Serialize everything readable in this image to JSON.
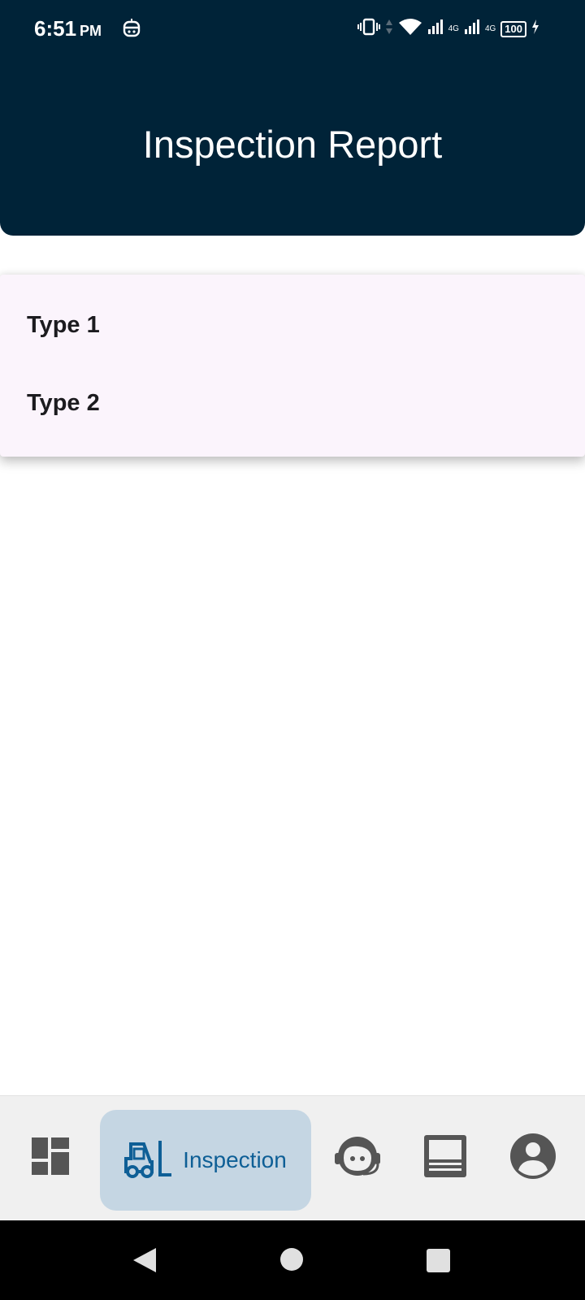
{
  "status_bar": {
    "time": "6:51",
    "ampm": "PM",
    "net1": "4G",
    "net2": "4G",
    "battery": "100"
  },
  "header": {
    "title": "Inspection Report"
  },
  "dropdown": {
    "options": [
      {
        "label": "Type 1"
      },
      {
        "label": "Type 2"
      }
    ]
  },
  "bottom_nav": {
    "items": [
      {
        "name": "dashboard",
        "icon": "dashboard-icon"
      },
      {
        "name": "inspection",
        "icon": "forklift-icon",
        "label": "Inspection",
        "selected": true
      },
      {
        "name": "support",
        "icon": "support-agent-icon"
      },
      {
        "name": "document",
        "icon": "document-icon"
      },
      {
        "name": "profile",
        "icon": "account-circle-icon"
      }
    ]
  },
  "colors": {
    "header_bg": "#002338",
    "accent": "#0e5f96",
    "selected_pill": "#c5d6e3",
    "dropdown_bg": "#fbf4fc"
  }
}
